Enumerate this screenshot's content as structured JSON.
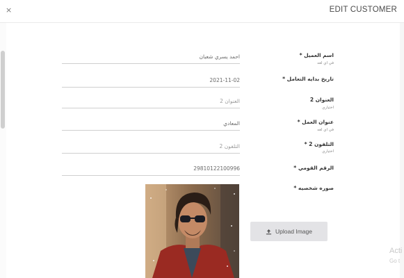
{
  "header": {
    "close_label": "×",
    "title": "EDIT CUSTOMER"
  },
  "form": {
    "fields": [
      {
        "label": "اسم العميل *",
        "hint": "في اي لغه",
        "value": "احمد يسري شعبان",
        "is_placeholder": false
      },
      {
        "label": "تاريخ بدايه التعامل *",
        "hint": "",
        "value": "2021-11-02",
        "is_placeholder": false
      },
      {
        "label": "العنوان 2",
        "hint": "اختياري",
        "value": "العنوان 2",
        "is_placeholder": true
      },
      {
        "label": "عنوان العمل *",
        "hint": "في اي لغه",
        "value": "المعادي",
        "is_placeholder": false
      },
      {
        "label": "التلفون 2 *",
        "hint": "اختياري",
        "value": "التلفون 2",
        "is_placeholder": true
      },
      {
        "label": "الرقم القومي *",
        "hint": "",
        "value": "29810122100996",
        "is_placeholder": false
      }
    ],
    "photo": {
      "label": "صوره شخصيه *",
      "upload_label": "Upload Image",
      "upload_icon": "upload-icon"
    }
  },
  "watermark": {
    "line1": "Acti",
    "line2": "Go t"
  },
  "colors": {
    "button_bg": "#e3e3e6",
    "border": "#cfcfcf",
    "title": "#4a4a4a"
  }
}
